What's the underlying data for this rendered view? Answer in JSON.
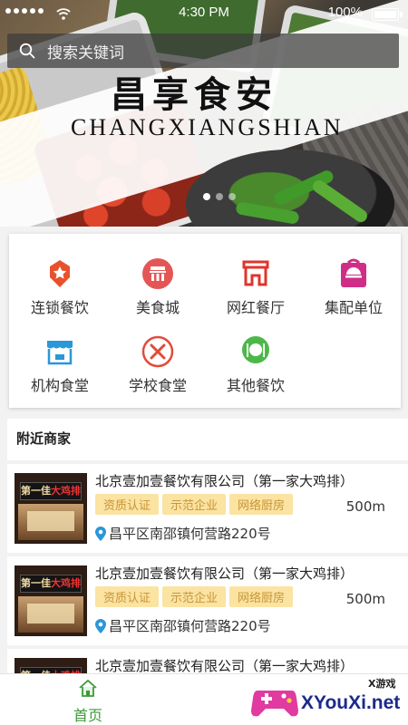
{
  "status_bar": {
    "time": "4:30 PM",
    "battery": "100%"
  },
  "search": {
    "placeholder": "搜索关键词"
  },
  "banner": {
    "title_cn": "昌享食安",
    "title_en": "CHANGXIANGSHIAN"
  },
  "categories": [
    {
      "label": "连锁餐饮",
      "icon": "chain-restaurant-icon",
      "color": "#e8512c"
    },
    {
      "label": "美食城",
      "icon": "food-court-icon",
      "color": "#e45656"
    },
    {
      "label": "网红餐厅",
      "icon": "storefront-icon",
      "color": "#e0342c"
    },
    {
      "label": "集配单位",
      "icon": "delivery-bag-icon",
      "color": "#d02e86"
    },
    {
      "label": "机构食堂",
      "icon": "canteen-shop-icon",
      "color": "#2a97d8"
    },
    {
      "label": "学校食堂",
      "icon": "fork-knife-icon",
      "color": "#e24a3a"
    },
    {
      "label": "其他餐饮",
      "icon": "dining-plate-icon",
      "color": "#4cb848"
    }
  ],
  "nearby": {
    "title": "附近商家",
    "items": [
      {
        "name": "北京壹加壹餐饮有限公司（第一家大鸡排）",
        "tags": [
          "资质认证",
          "示范企业",
          "网络厨房"
        ],
        "distance": "500m",
        "address": "昌平区南邵镇何营路220号"
      },
      {
        "name": "北京壹加壹餐饮有限公司（第一家大鸡排）",
        "tags": [
          "资质认证",
          "示范企业",
          "网络厨房"
        ],
        "distance": "500m",
        "address": "昌平区南邵镇何营路220号"
      },
      {
        "name": "北京壹加壹餐饮有限公司（第一家大鸡排）",
        "tags": [],
        "distance": "",
        "address": ""
      }
    ]
  },
  "tabbar": {
    "home_label": "首页"
  },
  "watermark": {
    "brand": "XYouXi.net",
    "tagline": "X游戏"
  },
  "colors": {
    "accent_green": "#3a9a37",
    "tag_bg": "#fbe3a2",
    "tag_text": "#c89537"
  }
}
